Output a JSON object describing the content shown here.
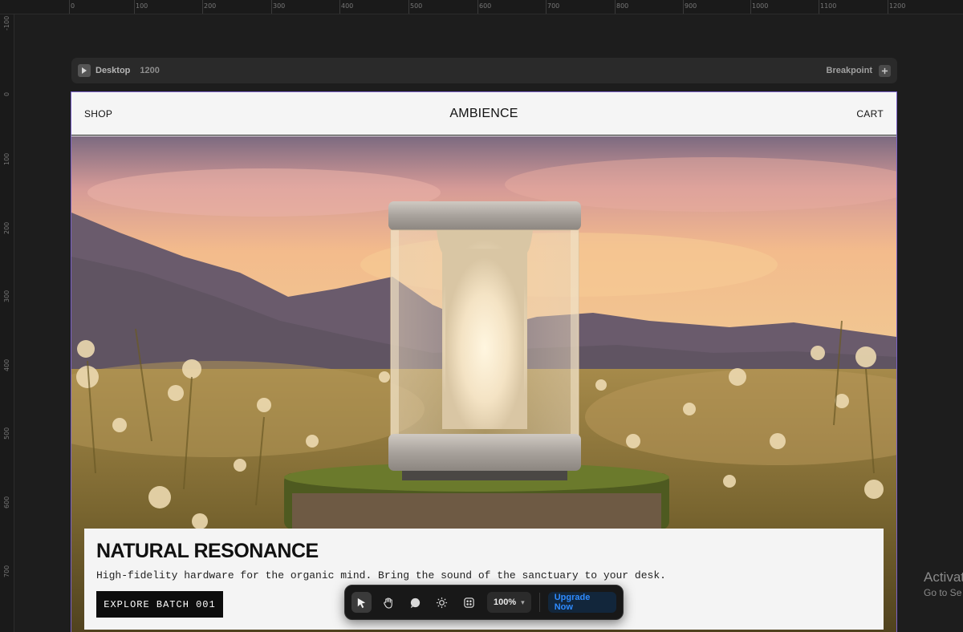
{
  "ruler": {
    "top_labels": [
      "0",
      "100",
      "200",
      "300",
      "400",
      "500",
      "600",
      "700",
      "800",
      "900",
      "1000",
      "1100",
      "1200"
    ],
    "left_labels": [
      "-100",
      "0",
      "100",
      "200",
      "300",
      "400",
      "500",
      "600",
      "700"
    ]
  },
  "breakpoint_bar": {
    "device": "Desktop",
    "width": "1200",
    "breakpoint_label": "Breakpoint",
    "add_icon": "plus-icon",
    "play_icon": "play-icon"
  },
  "site": {
    "nav": {
      "left": "SHOP",
      "brand": "AMBIENCE",
      "right": "CART"
    },
    "hero": {
      "title": "NATURAL RESONANCE",
      "subtitle": "High-fidelity hardware for the organic mind. Bring the sound of the sanctuary to your desk.",
      "cta": "EXPLORE BATCH 001"
    }
  },
  "toolbar": {
    "tools": [
      "pointer-icon",
      "hand-icon",
      "comment-icon",
      "sun-icon",
      "components-icon"
    ],
    "zoom": "100%",
    "upgrade": "Upgrade Now"
  },
  "os_watermark": {
    "line1": "Activat",
    "line2": "Go to Se"
  },
  "colors": {
    "accent_frame": "#7b62c9",
    "upgrade_text": "#2e8bff",
    "cta_bg": "#0d0d0d"
  }
}
